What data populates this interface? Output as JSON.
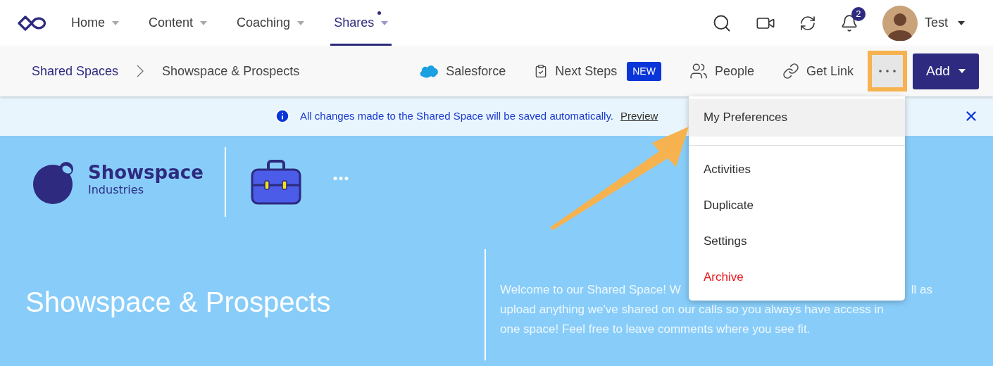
{
  "nav": {
    "items": [
      {
        "label": "Home",
        "selected": false,
        "dot": false
      },
      {
        "label": "Content",
        "selected": false,
        "dot": false
      },
      {
        "label": "Coaching",
        "selected": false,
        "dot": false
      },
      {
        "label": "Shares",
        "selected": true,
        "dot": true
      }
    ],
    "notifications": "2",
    "user": "Test"
  },
  "toolbar": {
    "breadcrumbs": [
      "Shared Spaces",
      "Showspace & Prospects"
    ],
    "actions": [
      {
        "kind": "salesforce",
        "label": "Salesforce"
      },
      {
        "kind": "steps",
        "label": "Next Steps",
        "badge": "NEW"
      },
      {
        "kind": "people",
        "label": "People"
      },
      {
        "kind": "link",
        "label": "Get Link"
      }
    ],
    "more_highlighted": true,
    "add": "Add"
  },
  "banner": {
    "message": "All changes made to the Shared Space will be saved automatically.",
    "link": "Preview"
  },
  "menu": {
    "items": [
      {
        "label": "My Preferences",
        "selected": true,
        "danger": false
      },
      {
        "label": "Activities",
        "selected": false,
        "danger": false
      },
      {
        "label": "Duplicate",
        "selected": false,
        "danger": false
      },
      {
        "label": "Settings",
        "selected": false,
        "danger": false
      },
      {
        "label": "Archive",
        "selected": false,
        "danger": true
      }
    ]
  },
  "hero": {
    "brand": "Showspace",
    "brand_sub": "Industries",
    "title": "Showspace & Prospects",
    "description_first_line": [
      "Welcome to our Shared Space! W",
      "ll as"
    ],
    "description_lines": [
      "upload anything we've shared on our calls so you always have access in",
      "one space! Feel free to leave comments where you see fit."
    ]
  }
}
